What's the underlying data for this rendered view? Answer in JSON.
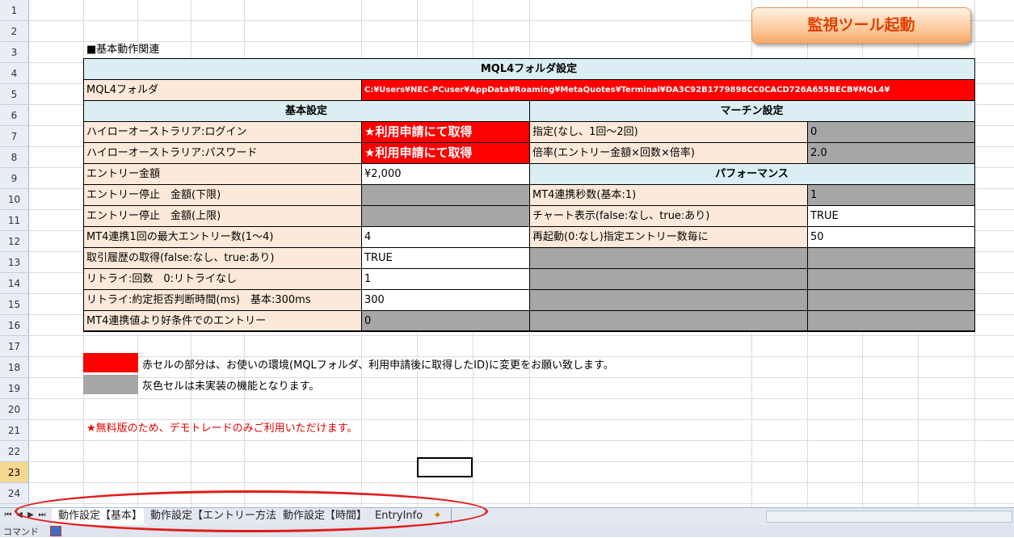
{
  "launch_button": "監視ツール起動",
  "section_title": "■基本動作関連",
  "rows": [
    "1",
    "2",
    "3",
    "4",
    "5",
    "6",
    "7",
    "8",
    "9",
    "10",
    "11",
    "12",
    "13",
    "14",
    "15",
    "16",
    "17",
    "18",
    "19",
    "20",
    "21",
    "22",
    "23",
    "24"
  ],
  "mql_header": "MQL4フォルダ設定",
  "mql_label": "MQL4フォルダ",
  "mql_path": "C:¥Users¥NEC-PCuser¥AppData¥Roaming¥MetaQuotes¥Terminal¥DA3C92B1779898CC0CACD726A655BECB¥MQL4¥",
  "basic_header": "基本設定",
  "martin_header": "マーチン設定",
  "performance_header": "パフォーマンス",
  "basic": [
    {
      "label": "ハイローオーストラリア:ログイン",
      "value": "★利用申請にて取得",
      "style": "red"
    },
    {
      "label": "ハイローオーストラリア:パスワード",
      "value": "★利用申請にて取得",
      "style": "red"
    },
    {
      "label": "エントリー金額",
      "value": "¥2,000",
      "style": "val"
    },
    {
      "label": "エントリー停止　金額(下限)",
      "value": "",
      "style": "gray"
    },
    {
      "label": "エントリー停止　金額(上限)",
      "value": "",
      "style": "gray"
    },
    {
      "label": "MT4連携1回の最大エントリー数(1～4)",
      "value": "4",
      "style": "val"
    },
    {
      "label": "取引履歴の取得(false:なし、true:あり)",
      "value": "TRUE",
      "style": "val"
    },
    {
      "label": "リトライ:回数　0:リトライなし",
      "value": "1",
      "style": "val"
    },
    {
      "label": "リトライ:約定拒否判断時間(ms)　基本:300ms",
      "value": "300",
      "style": "val"
    },
    {
      "label": "MT4連携値より好条件でのエントリー",
      "value": "0",
      "style": "gray"
    }
  ],
  "martin": [
    {
      "label": "指定(なし、1回～2回)",
      "value": "0"
    },
    {
      "label": "倍率(エントリー金額×回数×倍率)",
      "value": "2.0"
    }
  ],
  "performance": [
    {
      "label": "MT4連携秒数(基本:1)",
      "value": "1",
      "style": "gray"
    },
    {
      "label": "チャート表示(false:なし、true:あり)",
      "value": "TRUE",
      "style": "val"
    },
    {
      "label": "再起動(0:なし)指定エントリー数毎に",
      "value": "50",
      "style": "val"
    }
  ],
  "legend": {
    "red_text": "赤セルの部分は、お使いの環境(MQLフォルダ、利用申請後に取得したID)に変更をお願い致します。",
    "gray_text": "灰色セルは未実装の機能となります。"
  },
  "note": "★無料版のため、デモトレードのみご利用いただけます。",
  "tabs": [
    "動作設定【基本】",
    "動作設定【エントリー方法】",
    "動作設定【時間】",
    "EntryInfo"
  ],
  "status": "コマンド",
  "colors": {
    "red": "#ff0000",
    "gray": "#a6a6a6",
    "label_bg": "#fde9d9",
    "header_bg": "#daeef3",
    "accent": "#e31b1b"
  }
}
